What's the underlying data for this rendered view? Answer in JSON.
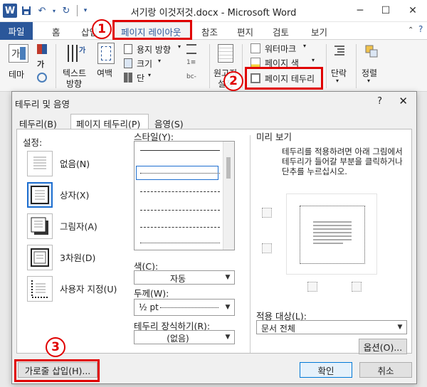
{
  "window": {
    "title": "서기랑 이것저것.docx - Microsoft Word",
    "app_icon_letter": "W",
    "minimize": "─",
    "maximize": "☐",
    "close": "✕"
  },
  "ribbon_tabs": {
    "file": "파일",
    "home": "홈",
    "insert": "삽입",
    "page_layout": "페이지 레이아웃",
    "references": "참조",
    "mailings": "편지",
    "review": "검토",
    "view": "보기"
  },
  "ribbon": {
    "themes": "테마",
    "text_direction_1": "텍스트",
    "text_direction_2": "방향",
    "margins": "여백",
    "orientation": "용지 방향",
    "size": "크기",
    "columns": "단",
    "manuscript_1": "원고지",
    "manuscript_2": "설정",
    "watermark": "워터마크",
    "page_color": "페이지 색",
    "page_borders": "페이지 테두리",
    "paragraph": "단락",
    "arrange": "정렬"
  },
  "markers": {
    "m1": "1",
    "m2": "2",
    "m3": "3"
  },
  "dialog": {
    "title": "테두리 및 음영",
    "help": "?",
    "close": "✕",
    "tabs": [
      "테두리(B)",
      "페이지 테두리(P)",
      "음영(S)"
    ],
    "setting_label": "설정:",
    "settings": [
      "없음(N)",
      "상자(X)",
      "그림자(A)",
      "3차원(D)",
      "사용자 지정(U)"
    ],
    "style_label": "스타일(Y):",
    "color_label": "색(C):",
    "color_value": "자동",
    "width_label": "두께(W):",
    "width_value": "½ pt",
    "art_label": "테두리 장식하기(R):",
    "art_value": "(없음)",
    "preview_label": "미리 보기",
    "preview_help": "테두리를 적용하려면 아래 그림에서 테두리가 들어갈 부분을 클릭하거나 단추를 누르십시오.",
    "apply_label": "적용 대상(L):",
    "apply_value": "문서 전체",
    "options_button": "옵션(O)...",
    "horizontal_line_button": "가로줄 삽입(H)...",
    "ok_button": "확인",
    "cancel_button": "취소"
  },
  "colors": {
    "accent": "#2b579a",
    "annotation": "#e00000",
    "selection": "#1e6fd0"
  }
}
